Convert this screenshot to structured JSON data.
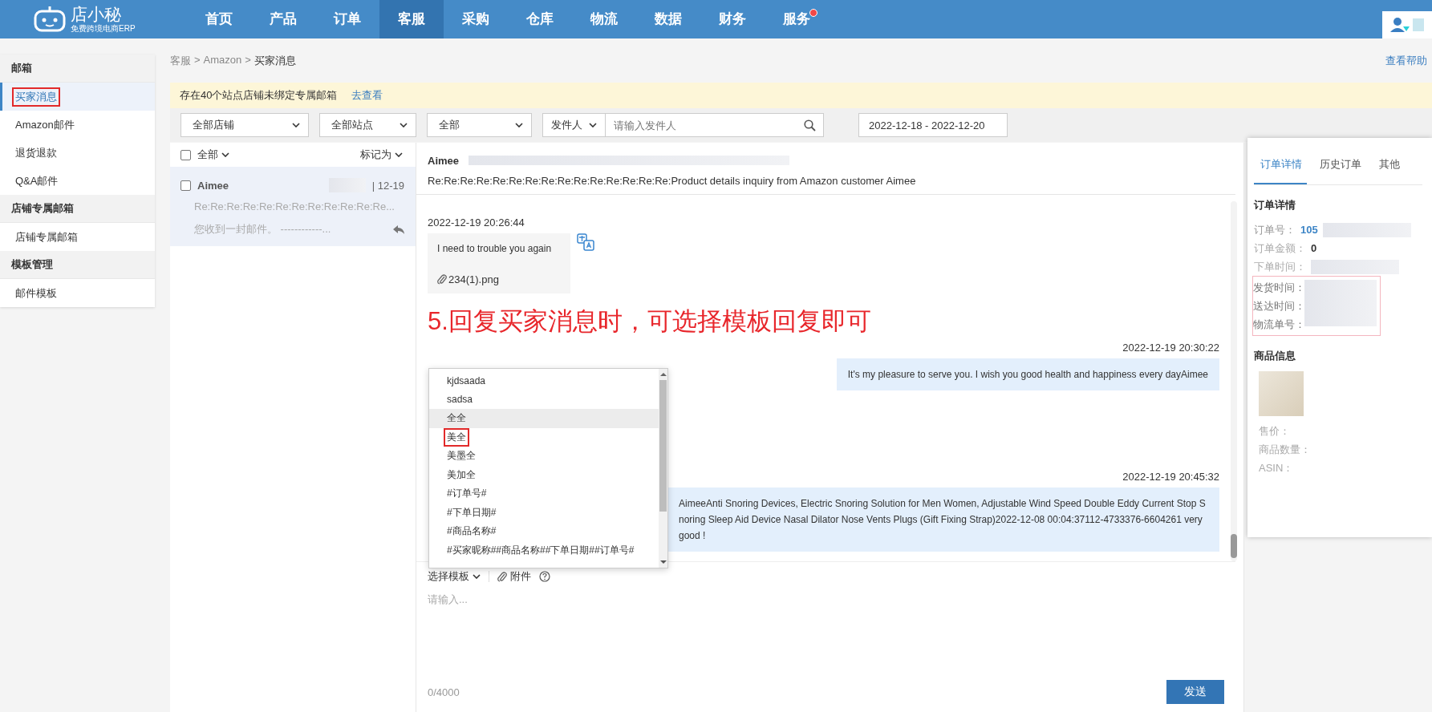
{
  "nav": {
    "logo": "店小秘",
    "logo_sub": "免费跨境电商ERP",
    "items": [
      {
        "label": "首页",
        "selected": false,
        "badge": false
      },
      {
        "label": "产品",
        "selected": false,
        "badge": false
      },
      {
        "label": "订单",
        "selected": false,
        "badge": false
      },
      {
        "label": "客服",
        "selected": true,
        "badge": false
      },
      {
        "label": "采购",
        "selected": false,
        "badge": false
      },
      {
        "label": "仓库",
        "selected": false,
        "badge": false
      },
      {
        "label": "物流",
        "selected": false,
        "badge": false
      },
      {
        "label": "数据",
        "selected": false,
        "badge": false
      },
      {
        "label": "财务",
        "selected": false,
        "badge": false
      },
      {
        "label": "服务",
        "selected": false,
        "badge": true
      }
    ]
  },
  "sidebar": {
    "sections": [
      {
        "title": "邮箱",
        "items": [
          {
            "label": "买家消息",
            "selected": true,
            "highlighted": true
          },
          {
            "label": "Amazon邮件",
            "selected": false,
            "highlighted": false
          },
          {
            "label": "退货退款",
            "selected": false,
            "highlighted": false
          },
          {
            "label": "Q&A邮件",
            "selected": false,
            "highlighted": false
          }
        ]
      },
      {
        "title": "店铺专属邮箱",
        "items": [
          {
            "label": "店铺专属邮箱",
            "selected": false,
            "highlighted": false
          }
        ]
      },
      {
        "title": "模板管理",
        "items": [
          {
            "label": "邮件模板",
            "selected": false,
            "highlighted": false
          }
        ]
      }
    ]
  },
  "breadcrumb": [
    "客服",
    "Amazon",
    "买家消息"
  ],
  "breadcrumb_separator": ">",
  "help_link": "查看帮助",
  "notice": {
    "text": "存在40个站点店铺未绑定专属邮箱",
    "link": "去查看"
  },
  "filters": {
    "selects": [
      "全部店铺",
      "全部站点",
      "全部"
    ],
    "sender_select": "发件人",
    "sender_placeholder": "请输入发件人",
    "date_range": "2022-12-18 - 2022-12-20"
  },
  "mail_list": {
    "select_all": "全部",
    "select_all_checked": false,
    "mark_as": "标记为",
    "items": [
      {
        "sender": "Aimee",
        "date": "| 12-19",
        "subject": "Re:Re:Re:Re:Re:Re:Re:Re:Re:Re:Re:Re...",
        "preview": "您收到一封邮件。 ------------...",
        "selected": true,
        "checked": false
      }
    ]
  },
  "conversation": {
    "sender": "Aimee",
    "subject": "Re:Re:Re:Re:Re:Re:Re:Re:Re:Re:Re:Re:Re:Re:Re:Product details inquiry from Amazon customer Aimee",
    "messages": [
      {
        "kind": "incoming",
        "time": "2022-12-19 20:26:44",
        "text": "I need to trouble you again",
        "attachment": "234(1).png"
      },
      {
        "kind": "annotation",
        "text": "5.回复买家消息时，可选择模板回复即可"
      },
      {
        "kind": "outgoing",
        "time": "2022-12-19 20:30:22",
        "text": "It's my pleasure to serve you. I wish you good health and happiness every dayAimee"
      },
      {
        "kind": "outgoing",
        "time": "2022-12-19 20:45:32",
        "text": "AimeeAnti Snoring Devices, Electric Snoring Solution for Men Women, Adjustable Wind Speed Double Eddy Current Stop Snoring Sleep Aid Device Nasal Dilator Nose Vents Plugs (Gift Fixing Strap)2022-12-08 00:04:37112-4733376-6604261   very  good !"
      }
    ],
    "template_menu": [
      {
        "label": "kjdsaada",
        "hovered": false,
        "highlighted": false
      },
      {
        "label": "sadsa",
        "hovered": false,
        "highlighted": false
      },
      {
        "label": "全全",
        "hovered": true,
        "highlighted": false
      },
      {
        "label": "美全",
        "hovered": false,
        "highlighted": true
      },
      {
        "label": "美墨全",
        "hovered": false,
        "highlighted": false
      },
      {
        "label": "美加全",
        "hovered": false,
        "highlighted": false
      },
      {
        "label": "#订单号#",
        "hovered": false,
        "highlighted": false
      },
      {
        "label": "#下单日期#",
        "hovered": false,
        "highlighted": false
      },
      {
        "label": "#商品名称#",
        "hovered": false,
        "highlighted": false
      },
      {
        "label": "#买家昵称##商品名称##下单日期##订单号#",
        "hovered": false,
        "highlighted": false
      }
    ],
    "template_button": "选择模板",
    "attach_button": "附件",
    "reply_placeholder": "请输入...",
    "char_count": "0/4000",
    "send_button": "发送"
  },
  "order_panel": {
    "tabs": [
      {
        "label": "订单详情",
        "selected": true
      },
      {
        "label": "历史订单",
        "selected": false
      },
      {
        "label": "其他",
        "selected": false
      }
    ],
    "section_title": "订单详情",
    "fields": [
      {
        "label": "订单号：",
        "value": "105",
        "link": true,
        "redacted": true
      },
      {
        "label": "订单金额：",
        "value": "0",
        "link": false,
        "redacted": false
      },
      {
        "label": "下单时间：",
        "link": false,
        "redacted": true
      }
    ],
    "highlighted_fields": [
      {
        "label": "发货时间："
      },
      {
        "label": "送达时间："
      },
      {
        "label": "物流单号："
      }
    ],
    "product_title": "商品信息",
    "product_fields": [
      "售价：",
      "商品数量：",
      "ASIN："
    ]
  }
}
